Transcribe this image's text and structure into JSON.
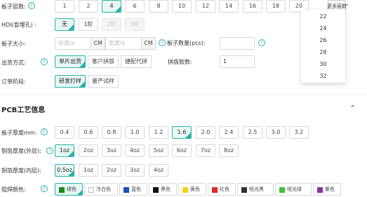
{
  "layers": {
    "label": "板子层数:",
    "options": [
      "1",
      "2",
      "4",
      "6",
      "8",
      "10",
      "12",
      "14",
      "16",
      "18",
      "20"
    ],
    "selected": "4",
    "more_label": "更多层数",
    "more_options": [
      "22",
      "24",
      "26",
      "28",
      "30",
      "32"
    ]
  },
  "hdi": {
    "label": "HDI(盲埋孔) :",
    "options": [
      "无",
      "1阶",
      "2阶",
      "3阶"
    ],
    "selected": "无"
  },
  "size": {
    "label": "板子大小:",
    "length_placeholder": "长度/x",
    "width_placeholder": "宽度/y",
    "unit": "CM"
  },
  "quantity": {
    "label": "板子数量(pcs):",
    "value": ""
  },
  "shipping": {
    "label": "出货方式:",
    "options": [
      "单片出货",
      "客户拼版",
      "捷配代拼"
    ],
    "selected": "单片出货",
    "panel_count_label": "拼版款数:",
    "panel_count_value": "1"
  },
  "order_stage": {
    "label": "订单阶段:",
    "options": [
      "研发打样",
      "量产试样"
    ],
    "selected": "研发打样"
  },
  "section": {
    "title": "PCB工艺信息"
  },
  "thickness": {
    "label": "板子厚度mm:",
    "options": [
      "0.4",
      "0.6",
      "0.8",
      "1.0",
      "1.2",
      "1.6",
      "2.0",
      "2.4",
      "2.5",
      "3.0",
      "3.2"
    ],
    "selected": "1.6"
  },
  "outer_copper": {
    "label": "铜箔厚度(外层):",
    "options": [
      "1oz",
      "2oz",
      "3oz",
      "4oz",
      "5oz",
      "6oz",
      "7oz",
      "8oz"
    ],
    "selected": "1oz"
  },
  "inner_copper": {
    "label": "铜箔厚度(内层):",
    "options": [
      "0.5oz",
      "1oz",
      "2oz",
      "3oz",
      "4oz"
    ],
    "selected": "0.5oz"
  },
  "solder_mask": {
    "label": "阻焊颜色:",
    "selected": "绿色",
    "colors": [
      {
        "name": "绿色",
        "hex": "#1a8a1a"
      },
      {
        "name": "冷白色",
        "hex": "#ffffff"
      },
      {
        "name": "蓝色",
        "hex": "#1f4fbf"
      },
      {
        "name": "黑色",
        "hex": "#111111"
      },
      {
        "name": "黄色",
        "hex": "#f2d21b"
      },
      {
        "name": "红色",
        "hex": "#d92b2b"
      },
      {
        "name": "哑光黑",
        "hex": "#333333"
      },
      {
        "name": "哑光绿",
        "hex": "#3fbf3f"
      },
      {
        "name": "紫色",
        "hex": "#8a2fa8"
      }
    ]
  },
  "icons": {
    "help": "?",
    "chevron": "⌄",
    "collapse": "⌃"
  },
  "colors": {
    "accent": "#2bb3a8",
    "selected_bg": "#e6f7f5"
  }
}
